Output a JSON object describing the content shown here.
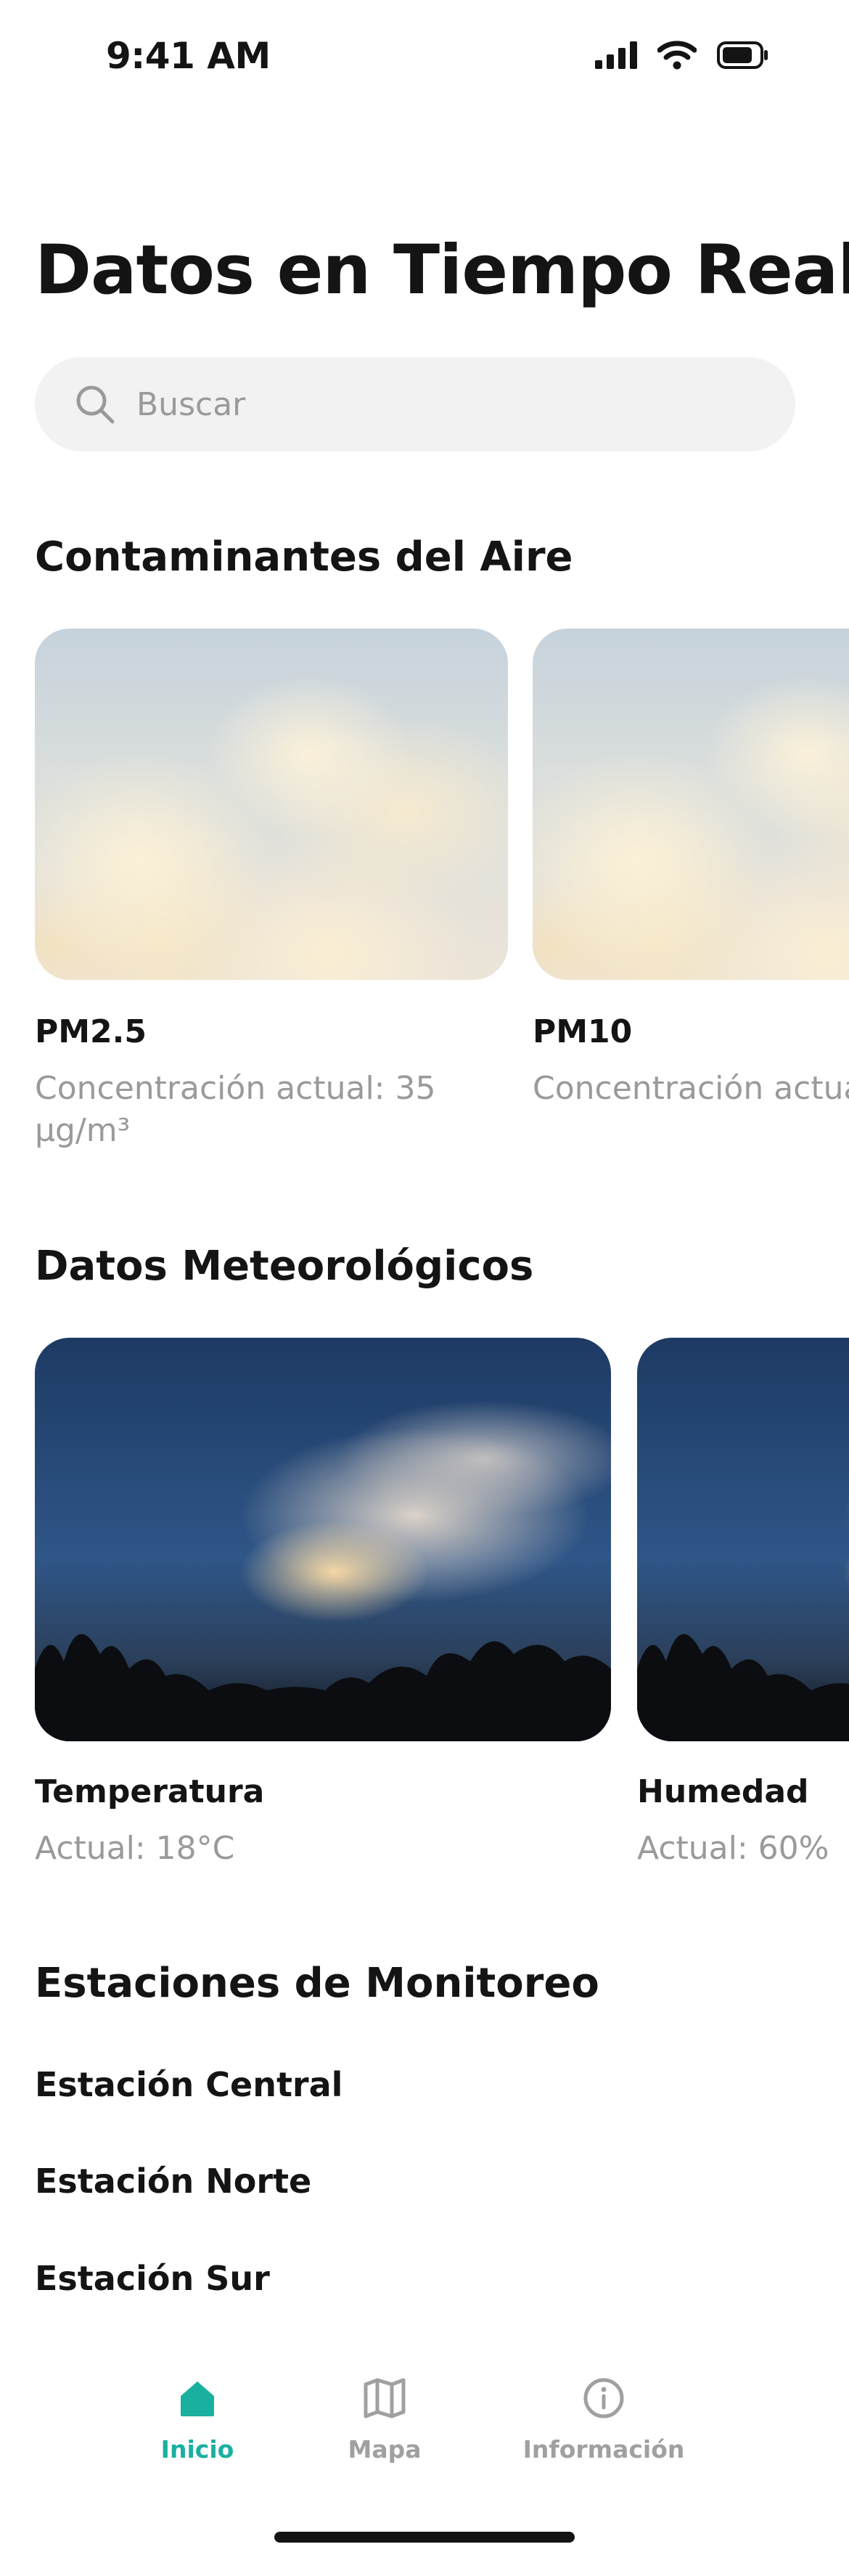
{
  "status_bar": {
    "time": "9:41 AM",
    "icons": [
      "cellular-signal-icon",
      "wifi-icon",
      "battery-icon"
    ]
  },
  "page_title": "Datos en Tiempo Real",
  "search": {
    "placeholder": "Buscar",
    "value": "",
    "icon": "search-icon"
  },
  "air_pollutants": {
    "title": "Contaminantes del Aire",
    "cards": [
      {
        "title": "PM2.5",
        "subtitle": "Concentración actual: 35 µg/m³"
      },
      {
        "title": "PM10",
        "subtitle": "Concentración actual"
      }
    ]
  },
  "weather": {
    "title": "Datos Meteorológicos",
    "cards": [
      {
        "title": "Temperatura",
        "subtitle": "Actual: 18°C"
      },
      {
        "title": "Humedad",
        "subtitle": "Actual: 60%"
      }
    ]
  },
  "stations": {
    "title": "Estaciones de Monitoreo",
    "items": [
      {
        "label": "Estación Central"
      },
      {
        "label": "Estación Norte"
      },
      {
        "label": "Estación Sur"
      }
    ]
  },
  "tab_bar": {
    "active_color": "#1ab0a0",
    "inactive_color": "#a0a0a0",
    "tabs": [
      {
        "label": "Inicio",
        "icon": "home-icon",
        "active": true
      },
      {
        "label": "Mapa",
        "icon": "map-icon",
        "active": false
      },
      {
        "label": "Información",
        "icon": "info-icon",
        "active": false
      }
    ]
  }
}
